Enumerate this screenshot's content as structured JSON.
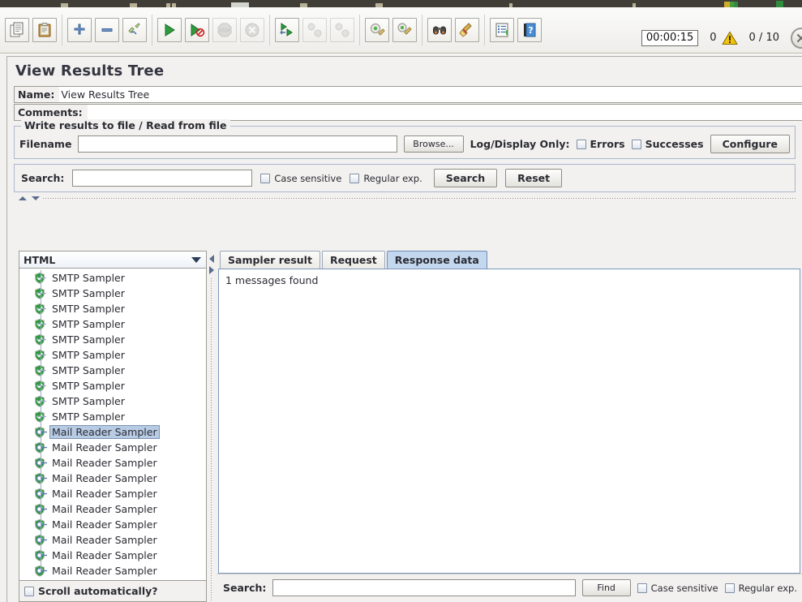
{
  "toolbar": {
    "buttons": [
      {
        "name": "new-button",
        "icon": "copy-pages-icon",
        "enabled": true
      },
      {
        "name": "templates-button",
        "icon": "clipboard-icon",
        "enabled": true
      },
      {
        "name": "expand-all-button",
        "icon": "plus-icon",
        "enabled": true
      },
      {
        "name": "collapse-all-button",
        "icon": "minus-icon",
        "enabled": true
      },
      {
        "name": "toggle-button",
        "icon": "pencil-toggle-icon",
        "enabled": true
      },
      {
        "name": "start-button",
        "icon": "play-green-icon",
        "enabled": true
      },
      {
        "name": "start-no-timers-button",
        "icon": "play-no-timer-icon",
        "enabled": true
      },
      {
        "name": "stop-button",
        "icon": "stop-sign-icon",
        "enabled": false
      },
      {
        "name": "shutdown-button",
        "icon": "shutdown-x-icon",
        "enabled": false
      },
      {
        "name": "start-remote-all-button",
        "icon": "play-remote-icon",
        "enabled": true
      },
      {
        "name": "stop-remote-all-button",
        "icon": "stop-remote-icon",
        "enabled": false
      },
      {
        "name": "shutdown-remote-all-button",
        "icon": "shutdown-remote-icon",
        "enabled": false
      },
      {
        "name": "clear-button",
        "icon": "gear-broom-icon",
        "enabled": true
      },
      {
        "name": "clear-all-button",
        "icon": "gear-broom-all-icon",
        "enabled": true
      },
      {
        "name": "search-tree-button",
        "icon": "binoculars-icon",
        "enabled": true
      },
      {
        "name": "reset-search-button",
        "icon": "broom-icon",
        "enabled": true
      },
      {
        "name": "function-helper-button",
        "icon": "list-lines-icon",
        "enabled": true
      },
      {
        "name": "help-button",
        "icon": "help-book-icon",
        "enabled": true
      }
    ]
  },
  "status": {
    "elapsed": "00:00:15",
    "warning_count": "0",
    "threads": "0 / 10"
  },
  "header": {
    "title": "View Results Tree",
    "name_label": "Name:",
    "name_value": "View Results Tree",
    "comments_label": "Comments:",
    "comments_value": ""
  },
  "file_group": {
    "title": "Write results to file / Read from file",
    "filename_label": "Filename",
    "filename_value": "",
    "browse_label": "Browse...",
    "log_display_label": "Log/Display Only:",
    "errors_label": "Errors",
    "errors_checked": false,
    "successes_label": "Successes",
    "successes_checked": false,
    "configure_label": "Configure"
  },
  "tree_search": {
    "label": "Search:",
    "value": "",
    "case_sensitive_label": "Case sensitive",
    "case_sensitive_checked": false,
    "regex_label": "Regular exp.",
    "regex_checked": false,
    "search_button": "Search",
    "reset_button": "Reset"
  },
  "left_pane": {
    "renderer_selected": "HTML",
    "scroll_auto_label": "Scroll automatically?",
    "scroll_auto_checked": false,
    "tree_nodes": [
      {
        "label": "SMTP Sampler",
        "status": "success",
        "expandable": false,
        "selected": false
      },
      {
        "label": "SMTP Sampler",
        "status": "success",
        "expandable": false,
        "selected": false
      },
      {
        "label": "SMTP Sampler",
        "status": "success",
        "expandable": false,
        "selected": false
      },
      {
        "label": "SMTP Sampler",
        "status": "success",
        "expandable": false,
        "selected": false
      },
      {
        "label": "SMTP Sampler",
        "status": "success",
        "expandable": false,
        "selected": false
      },
      {
        "label": "SMTP Sampler",
        "status": "success",
        "expandable": false,
        "selected": false
      },
      {
        "label": "SMTP Sampler",
        "status": "success",
        "expandable": false,
        "selected": false
      },
      {
        "label": "SMTP Sampler",
        "status": "success",
        "expandable": false,
        "selected": false
      },
      {
        "label": "SMTP Sampler",
        "status": "success",
        "expandable": false,
        "selected": false
      },
      {
        "label": "SMTP Sampler",
        "status": "success",
        "expandable": false,
        "selected": false
      },
      {
        "label": "Mail Reader Sampler",
        "status": "success",
        "expandable": true,
        "selected": true
      },
      {
        "label": "Mail Reader Sampler",
        "status": "success",
        "expandable": true,
        "selected": false
      },
      {
        "label": "Mail Reader Sampler",
        "status": "success",
        "expandable": true,
        "selected": false
      },
      {
        "label": "Mail Reader Sampler",
        "status": "success",
        "expandable": true,
        "selected": false
      },
      {
        "label": "Mail Reader Sampler",
        "status": "success",
        "expandable": true,
        "selected": false
      },
      {
        "label": "Mail Reader Sampler",
        "status": "success",
        "expandable": true,
        "selected": false
      },
      {
        "label": "Mail Reader Sampler",
        "status": "success",
        "expandable": true,
        "selected": false
      },
      {
        "label": "Mail Reader Sampler",
        "status": "success",
        "expandable": true,
        "selected": false
      },
      {
        "label": "Mail Reader Sampler",
        "status": "success",
        "expandable": true,
        "selected": false
      },
      {
        "label": "Mail Reader Sampler",
        "status": "success",
        "expandable": true,
        "selected": false
      }
    ]
  },
  "right_pane": {
    "tabs": [
      {
        "label": "Sampler result",
        "active": false
      },
      {
        "label": "Request",
        "active": false
      },
      {
        "label": "Response data",
        "active": true
      }
    ],
    "response_text": "1 messages found",
    "bottom_search": {
      "label": "Search:",
      "value": "",
      "find_button": "Find",
      "case_sensitive_label": "Case sensitive",
      "case_sensitive_checked": false,
      "regex_label": "Regular exp.",
      "regex_checked": false
    }
  },
  "colors": {
    "success_green": "#2e9b3e",
    "accent_blue": "#c3d7ee",
    "selection_blue": "#b8cbe4",
    "warning_yellow": "#f2c40c",
    "panel_bg": "#f2f1ef",
    "toolbar_dark": "#403e37"
  }
}
